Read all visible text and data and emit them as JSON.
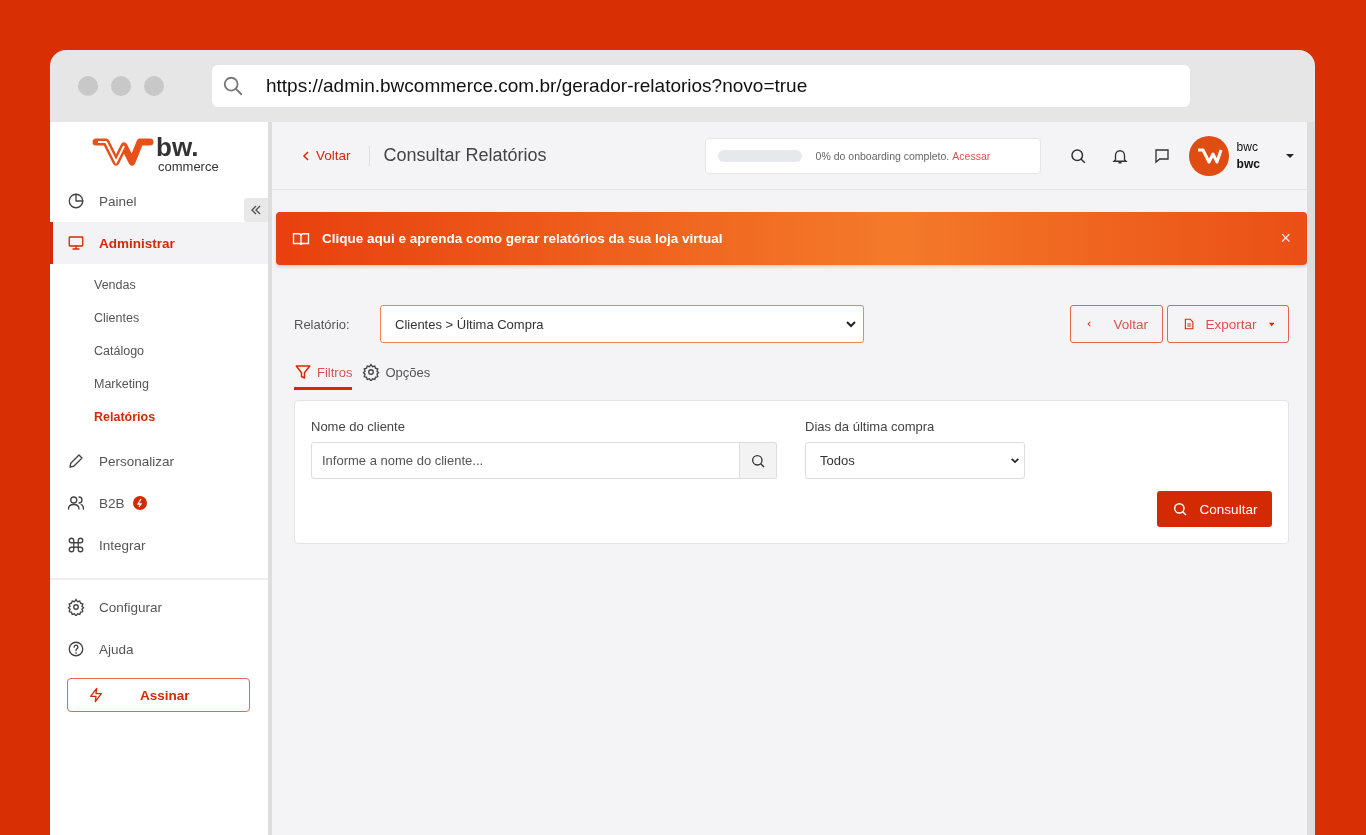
{
  "browser": {
    "url": "https://admin.bwcommerce.com.br/gerador-relatorios?novo=true"
  },
  "sidebar": {
    "logo": {
      "wordmark": "bw.",
      "tagline": "commerce"
    },
    "items": [
      {
        "label": "Painel",
        "selected": false
      },
      {
        "label": "Administrar",
        "selected": true,
        "children": [
          {
            "label": "Vendas",
            "selected": false
          },
          {
            "label": "Clientes",
            "selected": false
          },
          {
            "label": "Catálogo",
            "selected": false
          },
          {
            "label": "Marketing",
            "selected": false
          },
          {
            "label": "Relatórios",
            "selected": true
          }
        ]
      },
      {
        "label": "Personalizar",
        "selected": false
      },
      {
        "label": "B2B",
        "selected": false,
        "badge": true
      },
      {
        "label": "Integrar",
        "selected": false
      }
    ],
    "footer_items": [
      {
        "label": "Configurar",
        "selected": false
      },
      {
        "label": "Ajuda",
        "selected": false
      }
    ],
    "subscribe_button": "Assinar"
  },
  "header": {
    "back_link": "Voltar",
    "title": "Consultar Relatórios",
    "onboarding": {
      "level": 0,
      "text": "0% do onboarding completo.",
      "link": "Acessar"
    },
    "user": {
      "name": "bwc",
      "company": "bwc"
    }
  },
  "banner": {
    "text": "Clique aqui e aprenda como gerar relatórios da sua loja virtual",
    "close": "×"
  },
  "report": {
    "label": "Relatório:",
    "value": "Clientes > Última Compra",
    "buttons": [
      "Voltar",
      "Exportar"
    ]
  },
  "tabs": [
    {
      "label": "Filtros",
      "selected": true
    },
    {
      "label": "Opções",
      "selected": false
    }
  ],
  "filters": {
    "fields": [
      {
        "kind": "search",
        "label": "Nome do cliente",
        "placeholder": "Informe a nome do cliente..."
      },
      {
        "kind": "select",
        "label": "Dias da última compra",
        "value": "Todos"
      }
    ],
    "submit": "Consultar"
  }
}
